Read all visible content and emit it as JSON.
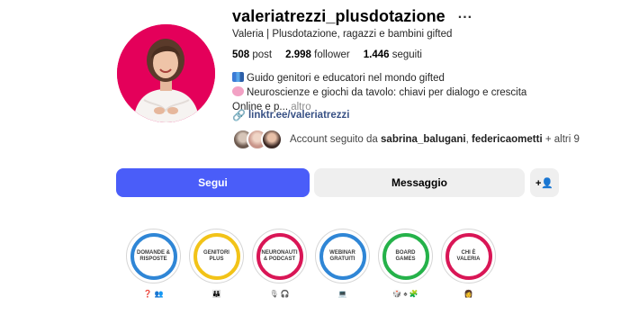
{
  "profile": {
    "username": "valeriatrezzi_plusdotazione",
    "more_icon": "...",
    "full_name": "Valeria | Plusdotazione, ragazzi e bambini gifted",
    "stats": {
      "posts_value": "508",
      "posts_label": "post",
      "followers_value": "2.998",
      "followers_label": "follower",
      "following_value": "1.446",
      "following_label": "seguiti"
    },
    "bio": {
      "line1": "Guido genitori e educatori nel mondo gifted",
      "line1_icon": "books-icon",
      "line2": "Neuroscienze e giochi da tavolo: chiavi per dialogo e crescita",
      "line2_icon": "brain-icon",
      "line3": "Online e p...",
      "more_label": "altro"
    },
    "link": {
      "icon": "🔗",
      "text": "linktr.ee/valeriatrezzi"
    },
    "followed_by": {
      "prefix": "Account seguito da",
      "user1": "sabrina_balugani",
      "separator": ",",
      "user2": "federicaometti",
      "suffix": "+ altri 9"
    },
    "colors": {
      "avatar_bg": "#e4005a",
      "follow_button": "#4a5df9"
    }
  },
  "actions": {
    "follow_label": "Segui",
    "message_label": "Messaggio",
    "add_user_icon": "+👤"
  },
  "highlights": [
    {
      "title": "Domande & Risposte",
      "ring_color": "#2f86d6",
      "icons": "❓ 👥"
    },
    {
      "title": "Genitori Plus",
      "ring_color": "#f2c318",
      "icons": "👪"
    },
    {
      "title": "Neuronauti & Podcast",
      "ring_color": "#d91656",
      "icons": "🎙 🎧"
    },
    {
      "title": "Webinar Gratuiti",
      "ring_color": "#2f86d6",
      "icons": "💻"
    },
    {
      "title": "Board Games",
      "ring_color": "#25b24a",
      "icons": "🎲 ♠ 🧩"
    },
    {
      "title": "Chi è Valeria",
      "ring_color": "#d91656",
      "icons": "👩"
    }
  ]
}
